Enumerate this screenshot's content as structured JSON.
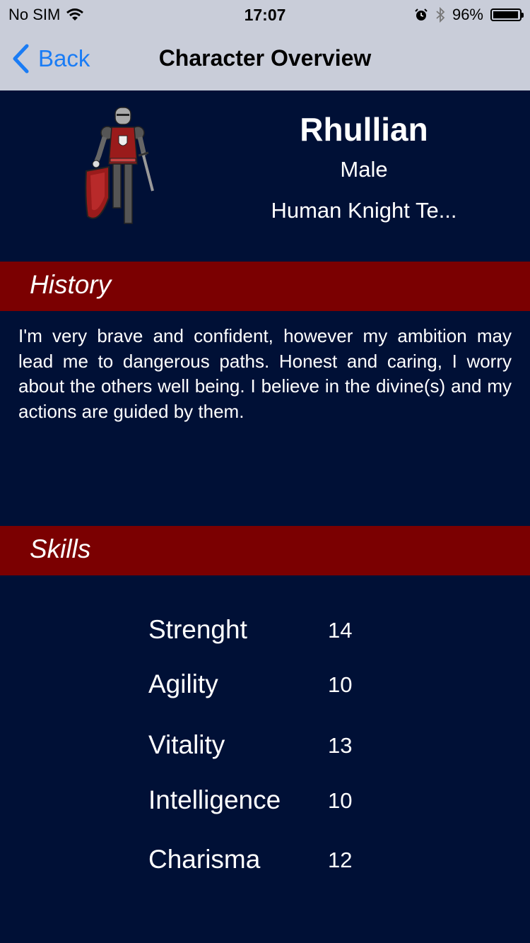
{
  "status_bar": {
    "carrier": "No SIM",
    "time": "17:07",
    "battery_percent": "96%",
    "battery_level": 0.96,
    "icons": [
      "wifi-icon",
      "alarm-icon",
      "bluetooth-icon",
      "battery-icon"
    ]
  },
  "nav": {
    "back_label": "Back",
    "title": "Character Overview"
  },
  "character": {
    "name": "Rhullian",
    "gender": "Male",
    "class": "Human Knight Te..."
  },
  "history": {
    "title": "History",
    "text": "I'm very brave and confident, however my ambition may lead me to dangerous paths. Honest and caring, I worry about the others well being. I believe in the divine(s) and my actions are guided by them."
  },
  "skills": {
    "title": "Skills",
    "items": [
      {
        "name": "Strenght",
        "value": "14"
      },
      {
        "name": "Agility",
        "value": "10"
      },
      {
        "name": "Vitality",
        "value": "13"
      },
      {
        "name": "Intelligence",
        "value": "10"
      },
      {
        "name": "Charisma",
        "value": "12"
      }
    ]
  },
  "colors": {
    "background": "#001036",
    "section_bar": "#7b0001",
    "bars": "#c9cdd9",
    "accent": "#1a7cf5"
  }
}
